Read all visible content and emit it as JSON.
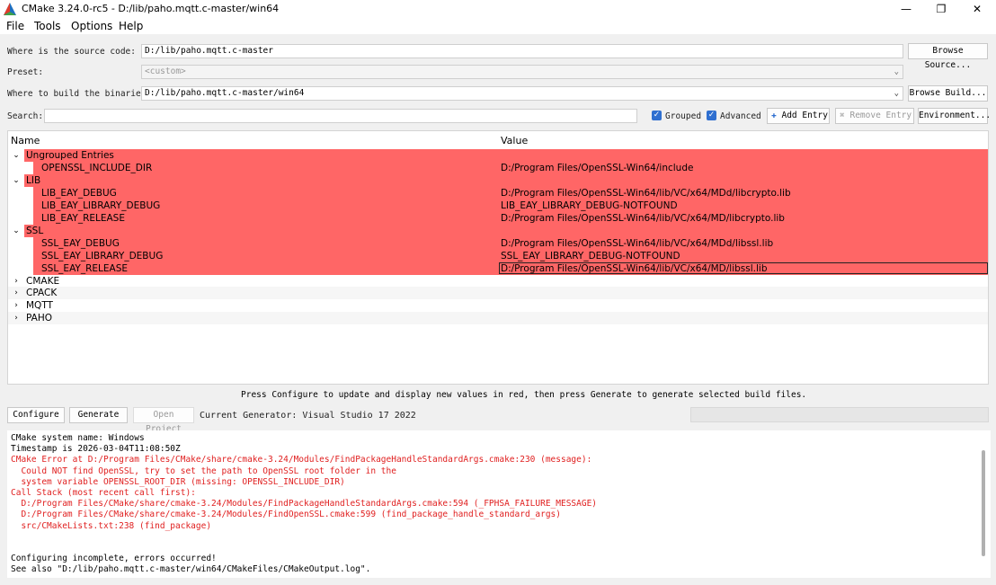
{
  "window": {
    "title": "CMake 3.24.0-rc5 - D:/lib/paho.mqtt.c-master/win64",
    "minimize": "—",
    "restore": "❐",
    "close": "✕"
  },
  "menu": [
    "File",
    "Tools",
    "Options",
    "Help"
  ],
  "source": {
    "label": "Where is the source code:",
    "value": "D:/lib/paho.mqtt.c-master",
    "button": "Browse Source..."
  },
  "preset": {
    "label": "Preset:",
    "value": "<custom>"
  },
  "build": {
    "label": "Where to build the binaries:",
    "value": "D:/lib/paho.mqtt.c-master/win64",
    "button": "Browse Build..."
  },
  "search": {
    "label": "Search:",
    "value": ""
  },
  "options": {
    "grouped": {
      "label": "Grouped",
      "checked": true
    },
    "advanced": {
      "label": "Advanced",
      "checked": true
    },
    "add_entry": "Add Entry",
    "remove_entry": "Remove Entry",
    "environment": "Environment..."
  },
  "tree": {
    "headers": {
      "name": "Name",
      "value": "Value"
    },
    "rows": [
      {
        "name": "Ungrouped Entries",
        "value": "",
        "group": true,
        "expanded": true,
        "red": true
      },
      {
        "name": "OPENSSL_INCLUDE_DIR",
        "value": "D:/Program Files/OpenSSL-Win64/include",
        "group": false,
        "red": true
      },
      {
        "name": "LIB",
        "value": "",
        "group": true,
        "expanded": true,
        "red": true
      },
      {
        "name": "LIB_EAY_DEBUG",
        "value": "D:/Program Files/OpenSSL-Win64/lib/VC/x64/MDd/libcrypto.lib",
        "group": false,
        "red": true
      },
      {
        "name": "LIB_EAY_LIBRARY_DEBUG",
        "value": "LIB_EAY_LIBRARY_DEBUG-NOTFOUND",
        "group": false,
        "red": true
      },
      {
        "name": "LIB_EAY_RELEASE",
        "value": "D:/Program Files/OpenSSL-Win64/lib/VC/x64/MD/libcrypto.lib",
        "group": false,
        "red": true
      },
      {
        "name": "SSL",
        "value": "",
        "group": true,
        "expanded": true,
        "red": true
      },
      {
        "name": "SSL_EAY_DEBUG",
        "value": "D:/Program Files/OpenSSL-Win64/lib/VC/x64/MDd/libssl.lib",
        "group": false,
        "red": true
      },
      {
        "name": "SSL_EAY_LIBRARY_DEBUG",
        "value": "SSL_EAY_LIBRARY_DEBUG-NOTFOUND",
        "group": false,
        "red": true
      },
      {
        "name": "SSL_EAY_RELEASE",
        "value": "D:/Program Files/OpenSSL-Win64/lib/VC/x64/MD/libssl.lib",
        "group": false,
        "red": true,
        "selected": true
      },
      {
        "name": "CMAKE",
        "value": "",
        "group": true,
        "expanded": false,
        "red": false
      },
      {
        "name": "CPACK",
        "value": "",
        "group": true,
        "expanded": false,
        "red": false
      },
      {
        "name": "MQTT",
        "value": "",
        "group": true,
        "expanded": false,
        "red": false
      },
      {
        "name": "PAHO",
        "value": "",
        "group": true,
        "expanded": false,
        "red": false
      }
    ]
  },
  "hint": "Press Configure to update and display new values in red, then press Generate to generate selected build files.",
  "actions": {
    "configure": "Configure",
    "generate": "Generate",
    "open_project": "Open Project",
    "generator": "Current Generator: Visual Studio 17 2022"
  },
  "output": [
    {
      "text": "CMake system name: Windows",
      "error": false
    },
    {
      "text": "Timestamp is 2026-03-04T11:08:50Z",
      "error": false
    },
    {
      "text": "CMake Error at D:/Program Files/CMake/share/cmake-3.24/Modules/FindPackageHandleStandardArgs.cmake:230 (message):",
      "error": true
    },
    {
      "text": "  Could NOT find OpenSSL, try to set the path to OpenSSL root folder in the",
      "error": true
    },
    {
      "text": "  system variable OPENSSL_ROOT_DIR (missing: OPENSSL_INCLUDE_DIR)",
      "error": true
    },
    {
      "text": "Call Stack (most recent call first):",
      "error": true
    },
    {
      "text": "  D:/Program Files/CMake/share/cmake-3.24/Modules/FindPackageHandleStandardArgs.cmake:594 (_FPHSA_FAILURE_MESSAGE)",
      "error": true
    },
    {
      "text": "  D:/Program Files/CMake/share/cmake-3.24/Modules/FindOpenSSL.cmake:599 (find_package_handle_standard_args)",
      "error": true
    },
    {
      "text": "  src/CMakeLists.txt:238 (find_package)",
      "error": true
    },
    {
      "text": "",
      "error": false
    },
    {
      "text": "",
      "error": false
    },
    {
      "text": "Configuring incomplete, errors occurred!",
      "error": false
    },
    {
      "text": "See also \"D:/lib/paho.mqtt.c-master/win64/CMakeFiles/CMakeOutput.log\".",
      "error": false
    }
  ],
  "colors": {
    "error_row": "#ff6666",
    "error_text": "#e02020",
    "checkbox": "#2f6fd0"
  }
}
